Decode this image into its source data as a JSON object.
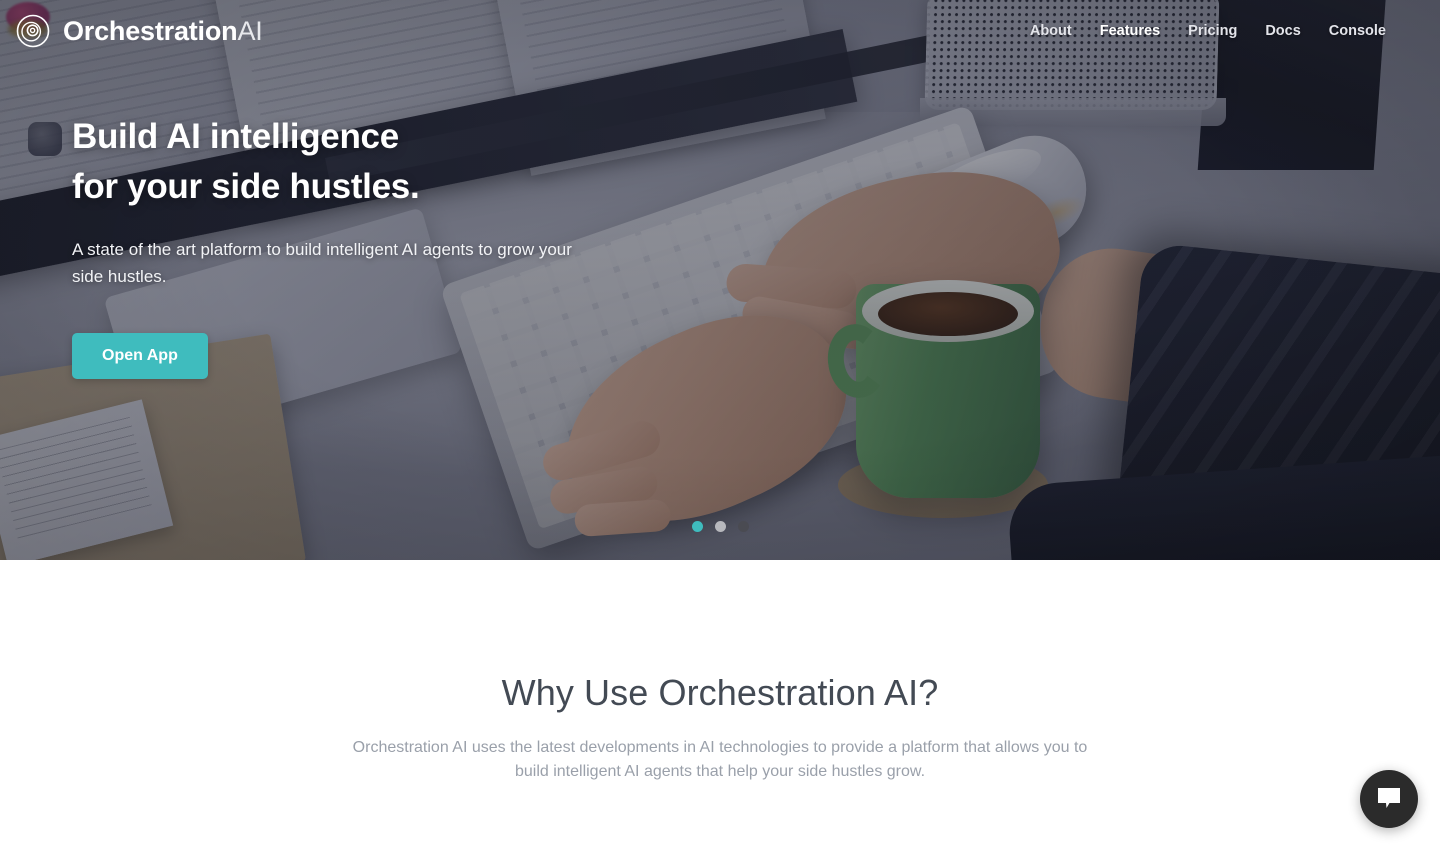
{
  "brand": {
    "name_strong": "Orchestration",
    "name_light": "AI",
    "logo_icon": "concentric-circle-logo-icon"
  },
  "nav": {
    "items": [
      {
        "label": "About",
        "active": false
      },
      {
        "label": "Features",
        "active": true
      },
      {
        "label": "Pricing",
        "active": false
      },
      {
        "label": "Docs",
        "active": false
      },
      {
        "label": "Console",
        "active": false
      }
    ]
  },
  "hero": {
    "title_line1": "Build AI intelligence",
    "title_line2": "for your side hustles.",
    "subtitle": "A state of the art platform to build intelligent AI agents to grow your side hustles.",
    "cta_label": "Open App",
    "carousel": {
      "slides": 3,
      "active_index": 0,
      "dot_states": [
        "active",
        "inactive",
        "dark"
      ]
    },
    "background_image_description": "Overhead photo of hands typing on an Apple keyboard with a green coffee mug, Magic Mouse, papers and a perforated speaker grille on a light desk, darkened by an overlay"
  },
  "why_section": {
    "title": "Why Use Orchestration AI?",
    "description": "Orchestration AI uses the latest developments in AI technologies to provide a platform that allows you to build intelligent AI agents that help your side hustles grow."
  },
  "chat_widget": {
    "icon": "chat-bubble-icon",
    "aria_label": "Open chat"
  },
  "colors": {
    "accent_teal": "#3fbcbe",
    "heading_slate": "#434a54",
    "body_gray": "#9aa0aa",
    "chat_dark": "#2b2b2b"
  }
}
